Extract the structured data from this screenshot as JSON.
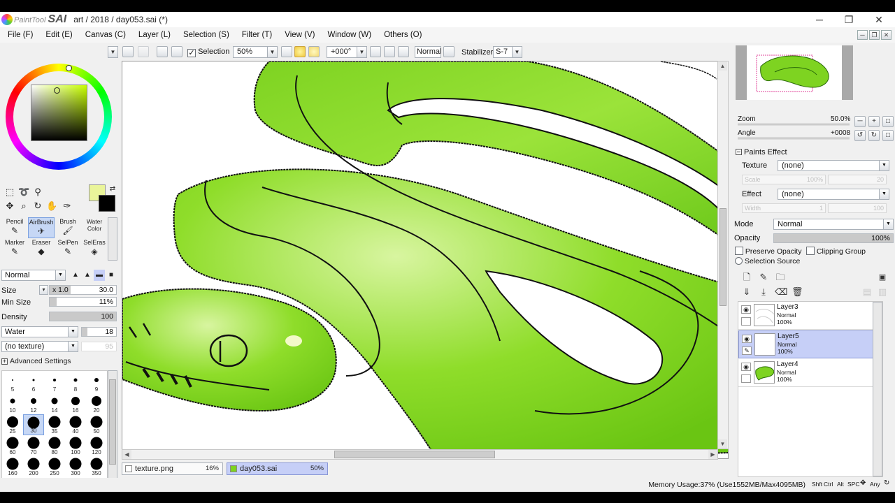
{
  "window": {
    "app_logo_text": "PaintTool",
    "app_logo_bold": "SAI",
    "title": "art / 2018 / day053.sai (*)",
    "minimize": "─",
    "maximize": "❐",
    "close": "✕"
  },
  "menu": [
    "File (F)",
    "Edit (E)",
    "Canvas (C)",
    "Layer (L)",
    "Selection (S)",
    "Filter (T)",
    "View (V)",
    "Window (W)",
    "Others (O)"
  ],
  "toolbar": {
    "selection_label": "Selection",
    "selection_checked": true,
    "zoom": "50%",
    "rotation": "+000°",
    "blend": "Normal",
    "stabilizer_label": "Stabilizer",
    "stabilizer": "S-7"
  },
  "color": {
    "foreground": "#eaf59a",
    "background": "#000000"
  },
  "tools": [
    {
      "label": "Pencil",
      "icon": "✎"
    },
    {
      "label": "AirBrush",
      "icon": "✈"
    },
    {
      "label": "Brush",
      "icon": "🖌"
    },
    {
      "label": "Water Color",
      "icon": "✒"
    },
    {
      "label": "Marker",
      "icon": "✎"
    },
    {
      "label": "Eraser",
      "icon": "◆"
    },
    {
      "label": "SelPen",
      "icon": "✎"
    },
    {
      "label": "SelEras",
      "icon": "◈"
    }
  ],
  "brush": {
    "mode": "Normal",
    "size_label": "Size",
    "size_mult": "x 1.0",
    "size": "30.0",
    "min_size_label": "Min Size",
    "min_size": "11%",
    "min_size_frac": 0.11,
    "density_label": "Density",
    "density": "100",
    "water_label": "Water",
    "water_value": "18",
    "texture": "(no texture)",
    "texture_value": "95",
    "advanced": "Advanced Settings"
  },
  "brush_sizes": [
    {
      "n": "5",
      "d": 2
    },
    {
      "n": "6",
      "d": 3
    },
    {
      "n": "7",
      "d": 4
    },
    {
      "n": "8",
      "d": 5
    },
    {
      "n": "9",
      "d": 6
    },
    {
      "n": "10",
      "d": 7
    },
    {
      "n": "12",
      "d": 8
    },
    {
      "n": "14",
      "d": 9
    },
    {
      "n": "16",
      "d": 12
    },
    {
      "n": "20",
      "d": 14
    },
    {
      "n": "25",
      "d": 16
    },
    {
      "n": "30",
      "d": 17
    },
    {
      "n": "35",
      "d": 17
    },
    {
      "n": "40",
      "d": 17
    },
    {
      "n": "50",
      "d": 17
    },
    {
      "n": "60",
      "d": 17
    },
    {
      "n": "70",
      "d": 17
    },
    {
      "n": "80",
      "d": 17
    },
    {
      "n": "100",
      "d": 17
    },
    {
      "n": "120",
      "d": 17
    },
    {
      "n": "160",
      "d": 17
    },
    {
      "n": "200",
      "d": 17
    },
    {
      "n": "250",
      "d": 17
    },
    {
      "n": "300",
      "d": 17
    },
    {
      "n": "350",
      "d": 17
    },
    {
      "n": "",
      "d": 17
    },
    {
      "n": "",
      "d": 17
    },
    {
      "n": "",
      "d": 17
    }
  ],
  "selected_brush": "30",
  "doc_tabs": [
    {
      "name": "texture.png",
      "zoom": "16%"
    },
    {
      "name": "day053.sai",
      "zoom": "50%"
    }
  ],
  "status": {
    "memory": "Memory Usage:37% (Use1552MB/Max4095MB)",
    "keys": [
      "Shft",
      "Ctrl",
      "Alt",
      "SPC",
      "Any"
    ]
  },
  "navigator": {
    "zoom_label": "Zoom",
    "zoom": "50.0%",
    "angle_label": "Angle",
    "angle": "+0008"
  },
  "paint_effect": {
    "title": "Paints Effect",
    "texture_label": "Texture",
    "texture": "(none)",
    "scale_label": "Scale",
    "scale": "100%",
    "scale_value": "20",
    "effect_label": "Effect",
    "effect": "(none)",
    "width_label": "Width",
    "width": "1",
    "width_value": "100"
  },
  "layer_props": {
    "mode_label": "Mode",
    "mode": "Normal",
    "opacity_label": "Opacity",
    "opacity": "100%",
    "preserve_opacity": "Preserve Opacity",
    "clipping_group": "Clipping Group",
    "selection_source": "Selection Source"
  },
  "layers": [
    {
      "name": "Layer3",
      "mode": "Normal",
      "opacity": "100%",
      "selected": false
    },
    {
      "name": "Layer5",
      "mode": "Normal",
      "opacity": "100%",
      "selected": true
    },
    {
      "name": "Layer4",
      "mode": "Normal",
      "opacity": "100%",
      "selected": false
    }
  ]
}
